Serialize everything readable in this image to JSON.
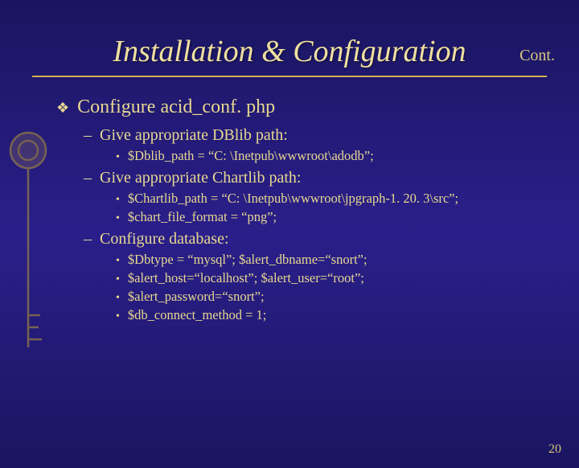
{
  "cont_label": "Cont.",
  "title": "Installation & Configuration",
  "level1_text": "Configure acid_conf. php",
  "section_a": {
    "heading": "Give appropriate DBlib path:",
    "items": [
      "$Dblib_path = “C: \\Inetpub\\wwwroot\\adodb”;"
    ]
  },
  "section_b": {
    "heading": "Give appropriate Chartlib path:",
    "items": [
      "$Chartlib_path = “C: \\Inetpub\\wwwroot\\jpgraph-1. 20. 3\\src”;",
      "$chart_file_format = “png”;"
    ]
  },
  "section_c": {
    "heading": "Configure database:",
    "items": [
      "$Dbtype = “mysql”; $alert_dbname=“snort”;",
      "$alert_host=“localhost”; $alert_user=“root”;",
      "$alert_password=“snort”;",
      "$db_connect_method = 1;"
    ]
  },
  "page_number": "20"
}
